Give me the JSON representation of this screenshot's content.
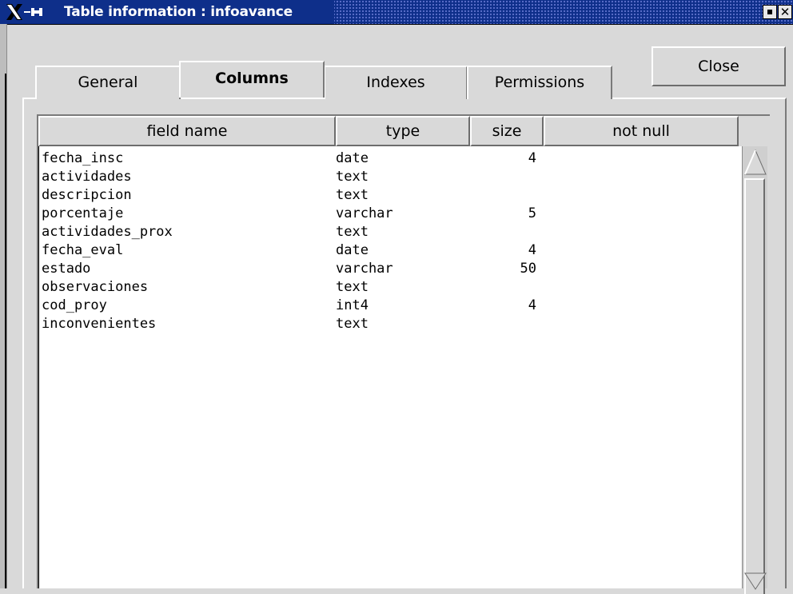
{
  "window": {
    "title": "Table information : infoavance",
    "minimize_icon": "minimize-icon",
    "close_icon": "close-icon"
  },
  "tabs": [
    {
      "label": "General",
      "active": false
    },
    {
      "label": "Columns",
      "active": true
    },
    {
      "label": "Indexes",
      "active": false
    },
    {
      "label": "Permissions",
      "active": false
    }
  ],
  "close_button": {
    "label": "Close"
  },
  "table": {
    "headers": [
      "field name",
      "type",
      "size",
      "not null"
    ],
    "rows": [
      {
        "name": "fecha_insc",
        "type": "date",
        "size": "4",
        "not_null": ""
      },
      {
        "name": "actividades",
        "type": "text",
        "size": "",
        "not_null": ""
      },
      {
        "name": "descripcion",
        "type": "text",
        "size": "",
        "not_null": ""
      },
      {
        "name": "porcentaje",
        "type": "varchar",
        "size": "5",
        "not_null": ""
      },
      {
        "name": "actividades_prox",
        "type": "text",
        "size": "",
        "not_null": ""
      },
      {
        "name": "fecha_eval",
        "type": "date",
        "size": "4",
        "not_null": ""
      },
      {
        "name": "estado",
        "type": "varchar",
        "size": "50",
        "not_null": ""
      },
      {
        "name": "observaciones",
        "type": "text",
        "size": "",
        "not_null": ""
      },
      {
        "name": "cod_proy",
        "type": "int4",
        "size": "4",
        "not_null": ""
      },
      {
        "name": "inconvenientes",
        "type": "text",
        "size": "",
        "not_null": ""
      }
    ]
  },
  "colors": {
    "titlebar": "#0e2f8a",
    "background": "#d9d9d9",
    "list_background": "#ffffff"
  }
}
